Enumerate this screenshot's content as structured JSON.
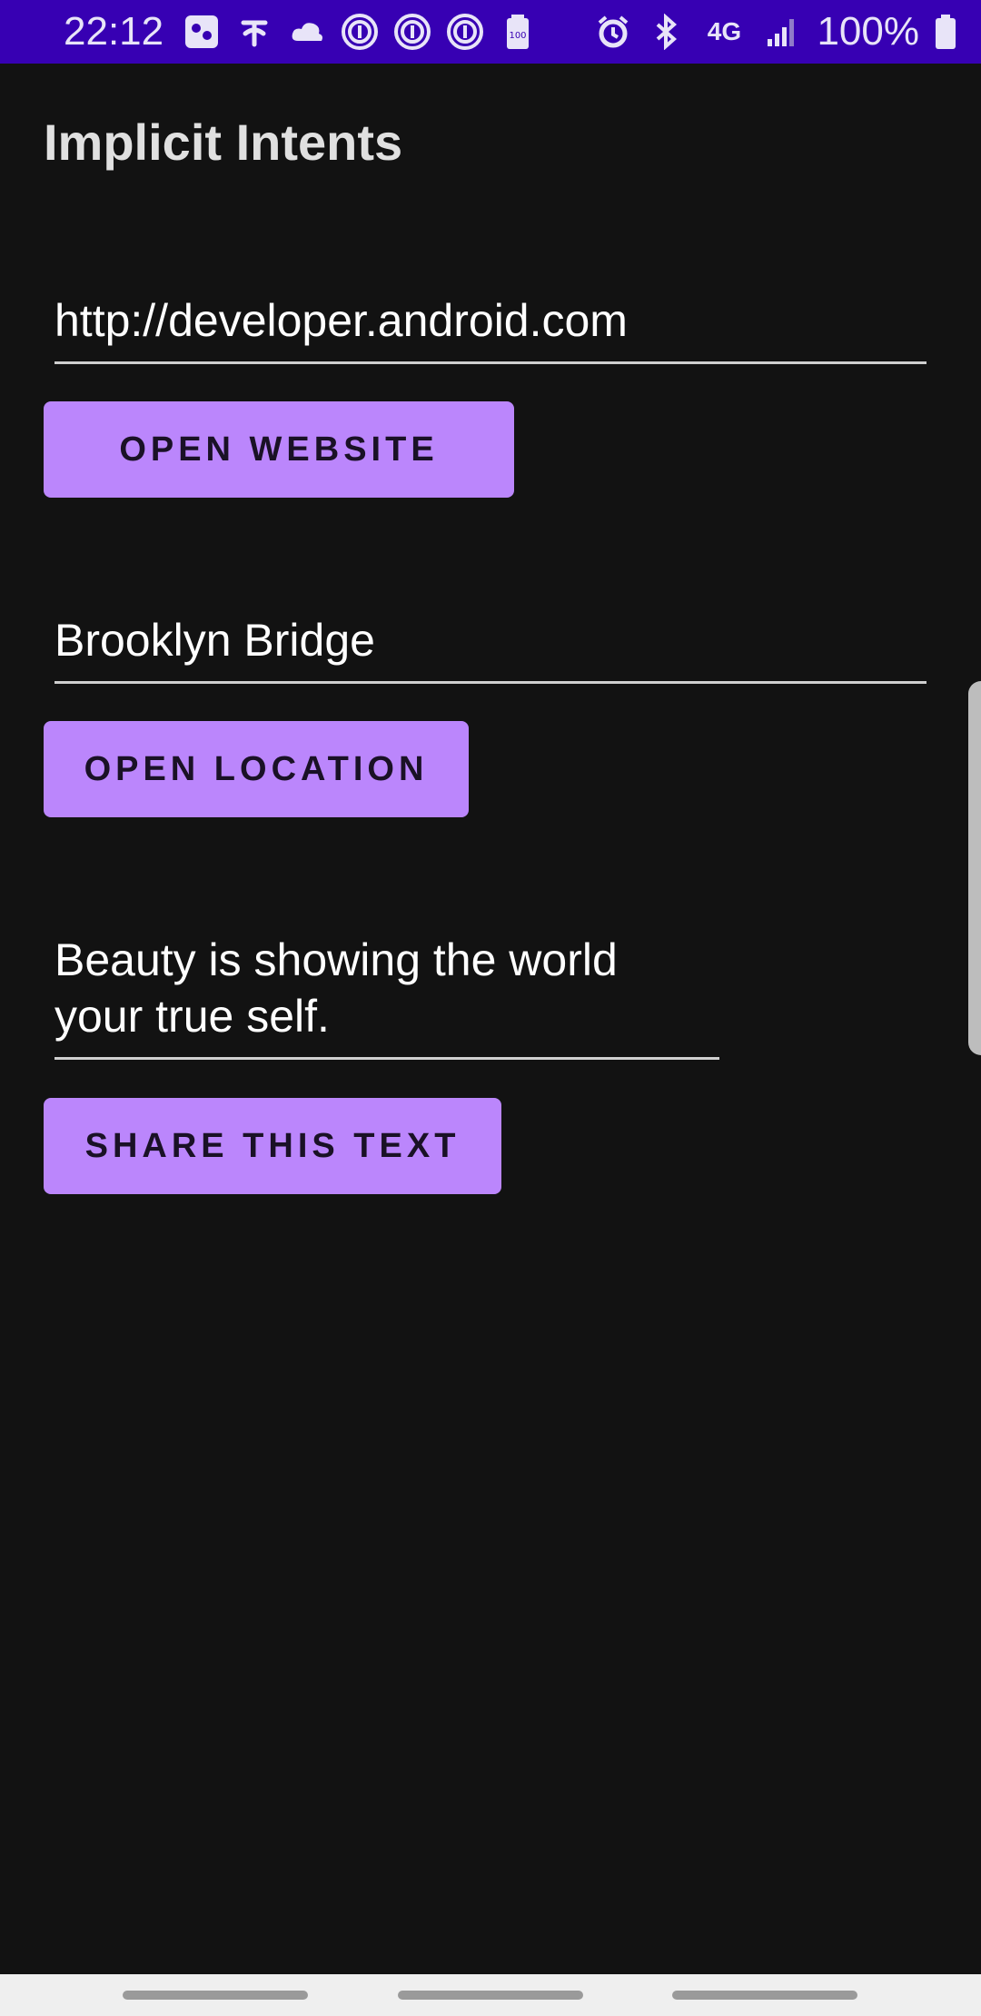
{
  "status_bar": {
    "time": "22:12",
    "battery_percent": "100%",
    "left_icons": [
      "game-icon",
      "nyt-icon",
      "cloud-icon",
      "fingerprint-icon",
      "fingerprint-icon",
      "fingerprint-icon",
      "battery-100-icon"
    ],
    "right_icons": [
      "alarm-icon",
      "bluetooth-icon",
      "4g-icon",
      "signal-icon",
      "battery-icon"
    ],
    "network_label": "4G"
  },
  "app": {
    "title": "Implicit Intents"
  },
  "website": {
    "value": "http://developer.android.com",
    "button_label": "OPEN WEBSITE"
  },
  "location": {
    "value": "Brooklyn Bridge",
    "button_label": "OPEN LOCATION"
  },
  "share": {
    "value_line1": "Beauty is showing the world",
    "value_line2": "your true self.",
    "button_label": "SHARE THIS TEXT"
  },
  "colors": {
    "status_bar": "#3700b3",
    "background": "#121212",
    "button": "#bb86fc"
  }
}
